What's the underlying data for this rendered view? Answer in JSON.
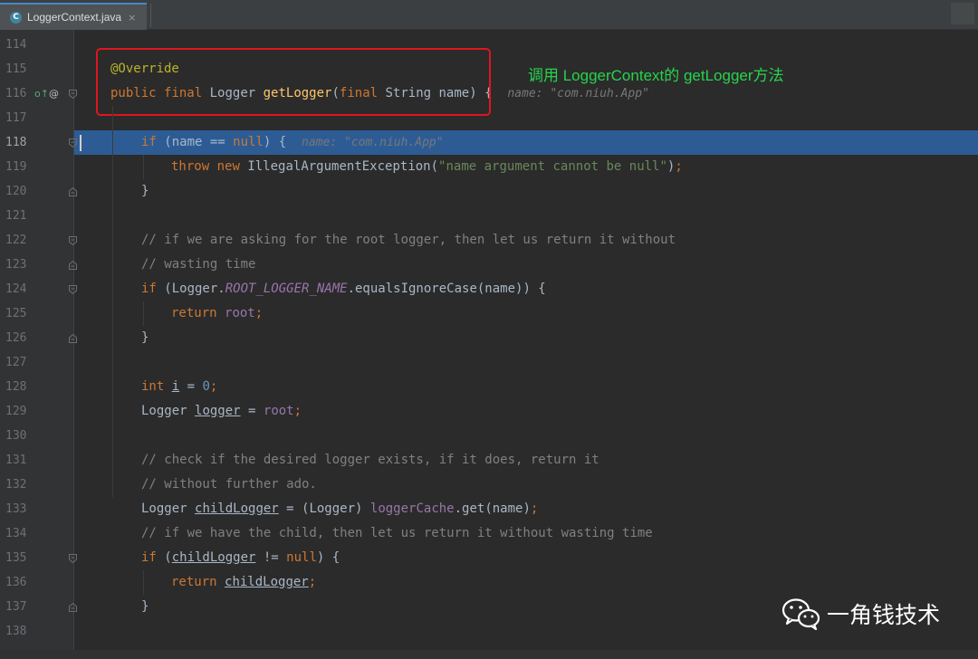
{
  "tab": {
    "icon_letter": "C",
    "label": "LoggerContext.java",
    "close": "×"
  },
  "colors": {
    "highlight_line": "#2d5c95",
    "annotation_box": "#e0151f",
    "note_text": "#27d34c"
  },
  "annotation_note": "调用 LoggerContext的 getLogger方法",
  "gutter_icons": {
    "override_marker": "o↑",
    "at_marker": "@"
  },
  "watermark": {
    "icon": "wechat-icon",
    "text": "一角钱技术"
  },
  "lines": [
    {
      "n": "114",
      "tokens": []
    },
    {
      "n": "115",
      "tokens": [
        {
          "c": "ann",
          "t": "@Override"
        }
      ]
    },
    {
      "n": "116",
      "tokens": [
        {
          "c": "kw",
          "t": "public"
        },
        {
          "c": "p",
          "t": " "
        },
        {
          "c": "kw",
          "t": "final"
        },
        {
          "c": "p",
          "t": " Logger "
        },
        {
          "c": "fn",
          "t": "getLogger"
        },
        {
          "c": "p",
          "t": "("
        },
        {
          "c": "kw",
          "t": "final"
        },
        {
          "c": "p",
          "t": " String name) {  "
        },
        {
          "c": "hint",
          "t": "name: \"com.niuh.App\""
        }
      ]
    },
    {
      "n": "117",
      "tokens": []
    },
    {
      "n": "118",
      "tokens": [
        {
          "c": "kw",
          "t": "if"
        },
        {
          "c": "p",
          "t": " (name == "
        },
        {
          "c": "kw",
          "t": "null"
        },
        {
          "c": "p",
          "t": ") {  "
        },
        {
          "c": "hint",
          "t": "name: \"com.niuh.App\""
        }
      ]
    },
    {
      "n": "119",
      "tokens": [
        {
          "c": "kw",
          "t": "throw"
        },
        {
          "c": "p",
          "t": " "
        },
        {
          "c": "kw",
          "t": "new"
        },
        {
          "c": "p",
          "t": " IllegalArgumentException("
        },
        {
          "c": "str",
          "t": "\"name argument cannot be null\""
        },
        {
          "c": "p",
          "t": ")"
        },
        {
          "c": "kw",
          "t": ";"
        }
      ]
    },
    {
      "n": "120",
      "tokens": [
        {
          "c": "p",
          "t": "}"
        }
      ]
    },
    {
      "n": "121",
      "tokens": []
    },
    {
      "n": "122",
      "tokens": [
        {
          "c": "cmt",
          "t": "// if we are asking for the root logger, then let us return it without"
        }
      ]
    },
    {
      "n": "123",
      "tokens": [
        {
          "c": "cmt",
          "t": "// wasting time"
        }
      ]
    },
    {
      "n": "124",
      "tokens": [
        {
          "c": "kw",
          "t": "if"
        },
        {
          "c": "p",
          "t": " (Logger."
        },
        {
          "c": "sfld",
          "t": "ROOT_LOGGER_NAME"
        },
        {
          "c": "p",
          "t": ".equalsIgnoreCase(name)) {"
        }
      ]
    },
    {
      "n": "125",
      "tokens": [
        {
          "c": "kw",
          "t": "return"
        },
        {
          "c": "p",
          "t": " "
        },
        {
          "c": "fld",
          "t": "root"
        },
        {
          "c": "kw",
          "t": ";"
        }
      ]
    },
    {
      "n": "126",
      "tokens": [
        {
          "c": "p",
          "t": "}"
        }
      ]
    },
    {
      "n": "127",
      "tokens": []
    },
    {
      "n": "128",
      "tokens": [
        {
          "c": "kw",
          "t": "int"
        },
        {
          "c": "p",
          "t": " "
        },
        {
          "c": "ul",
          "t": "i"
        },
        {
          "c": "p",
          "t": " = "
        },
        {
          "c": "num",
          "t": "0"
        },
        {
          "c": "kw",
          "t": ";"
        }
      ]
    },
    {
      "n": "129",
      "tokens": [
        {
          "c": "p",
          "t": "Logger "
        },
        {
          "c": "ul",
          "t": "logger"
        },
        {
          "c": "p",
          "t": " = "
        },
        {
          "c": "fld",
          "t": "root"
        },
        {
          "c": "kw",
          "t": ";"
        }
      ]
    },
    {
      "n": "130",
      "tokens": []
    },
    {
      "n": "131",
      "tokens": [
        {
          "c": "cmt",
          "t": "// check if the desired logger exists, if it does, return it"
        }
      ]
    },
    {
      "n": "132",
      "tokens": [
        {
          "c": "cmt",
          "t": "// without further ado."
        }
      ]
    },
    {
      "n": "133",
      "tokens": [
        {
          "c": "p",
          "t": "Logger "
        },
        {
          "c": "ul",
          "t": "childLogger"
        },
        {
          "c": "p",
          "t": " = (Logger) "
        },
        {
          "c": "fld",
          "t": "loggerCache"
        },
        {
          "c": "p",
          "t": ".get(name)"
        },
        {
          "c": "kw",
          "t": ";"
        }
      ]
    },
    {
      "n": "134",
      "tokens": [
        {
          "c": "cmt",
          "t": "// if we have the child, then let us return it without wasting time"
        }
      ]
    },
    {
      "n": "135",
      "tokens": [
        {
          "c": "kw",
          "t": "if"
        },
        {
          "c": "p",
          "t": " ("
        },
        {
          "c": "ul",
          "t": "childLogger"
        },
        {
          "c": "p",
          "t": " != "
        },
        {
          "c": "kw",
          "t": "null"
        },
        {
          "c": "p",
          "t": ") {"
        }
      ]
    },
    {
      "n": "136",
      "tokens": [
        {
          "c": "kw",
          "t": "return"
        },
        {
          "c": "p",
          "t": " "
        },
        {
          "c": "ul",
          "t": "childLogger"
        },
        {
          "c": "kw",
          "t": ";"
        }
      ]
    },
    {
      "n": "137",
      "tokens": [
        {
          "c": "p",
          "t": "}"
        }
      ]
    },
    {
      "n": "138",
      "tokens": []
    }
  ]
}
